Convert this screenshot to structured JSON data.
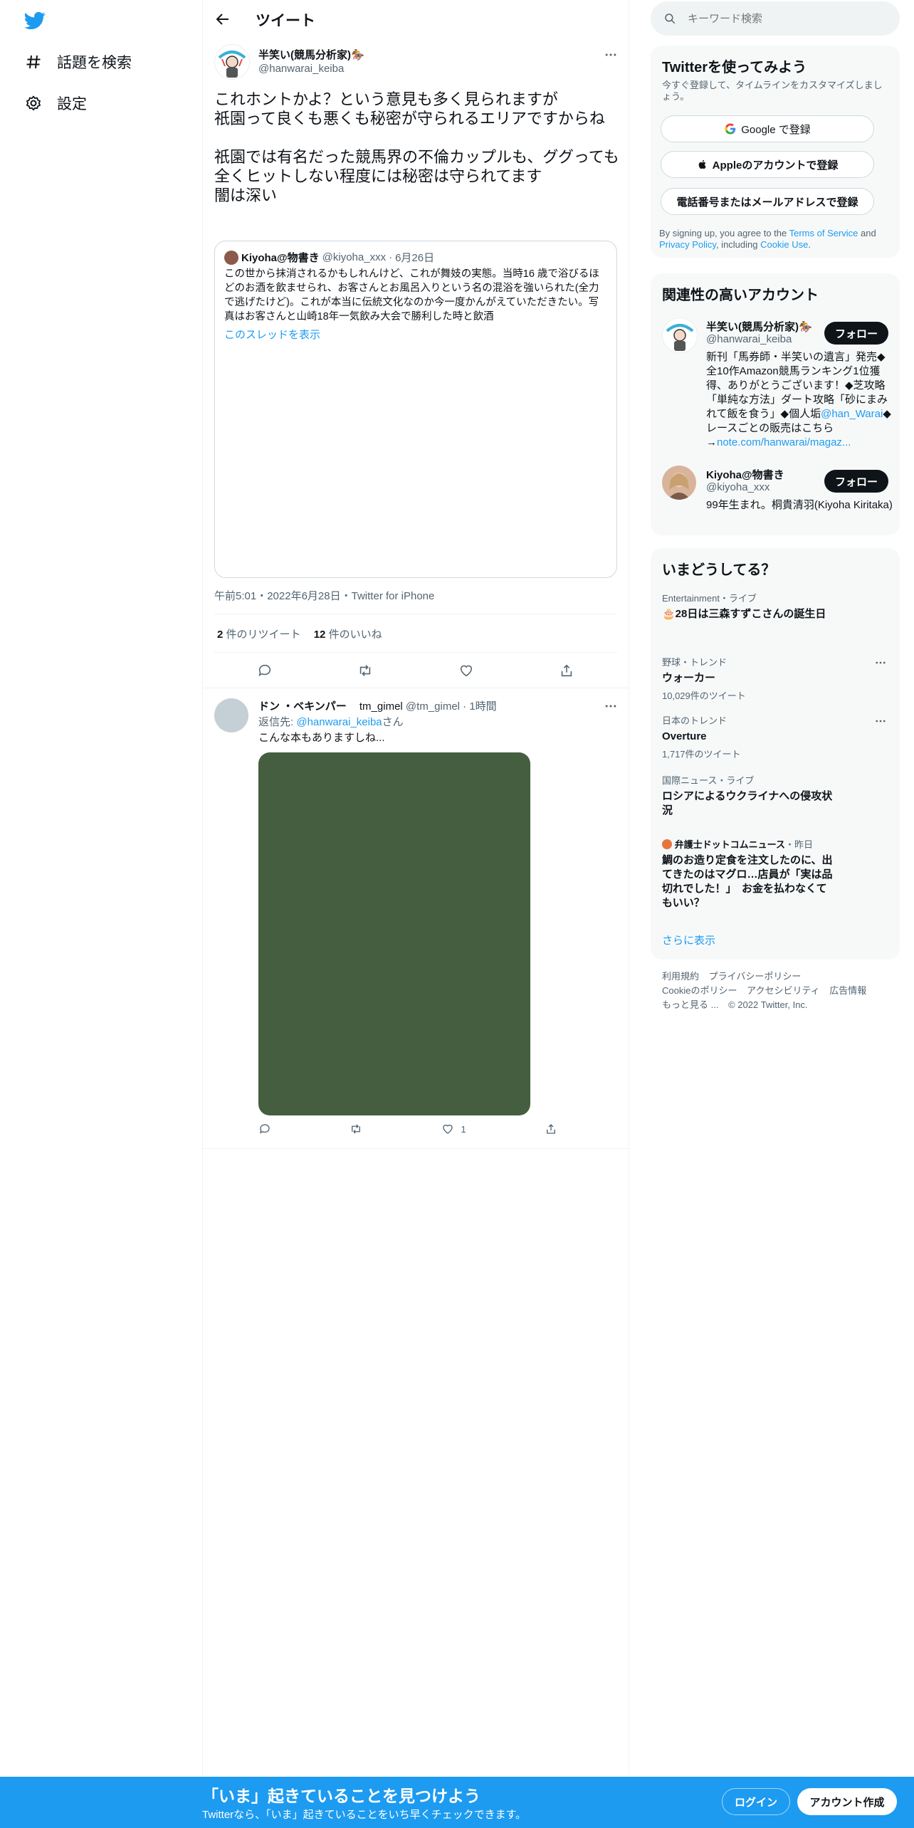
{
  "nav": {
    "items": [
      {
        "label": "話題を検索",
        "icon": "hashtag-icon"
      },
      {
        "label": "設定",
        "icon": "gear-icon"
      }
    ]
  },
  "header": {
    "title": "ツイート"
  },
  "tweet": {
    "author_name": "半笑い(競馬分析家)🏇",
    "handle": "@hanwarai_keiba",
    "text": "これホントかよ？という意見も多く見られますが\n祇園って良くも悪くも秘密が守られるエリアですからね\n\n祇園では有名だった競馬界の不倫カップルも、ググっても全くヒットしない程度には秘密は守られてます\n闇は深い",
    "quote": {
      "author_name": "Kiyoha@物書き",
      "handle": "@kiyoha_xxx",
      "date": "6月26日",
      "text": "この世から抹消されるかもしれんけど、これが舞妓の実態。当時16 歳で浴びるほどのお酒を飲ませられ、お客さんとお風呂入りという名の混浴を強いられた(全力で逃げたけど)。これが本当に伝統文化なのか今一度かんがえていただきたい。写真はお客さんと山崎18年一気飲み大会で勝利した時と飲酒",
      "show_thread": "このスレッドを表示"
    },
    "time": "午前5:01",
    "date": "2022年6月28日",
    "source": "Twitter for iPhone",
    "retweets": "2",
    "retweets_label": "件のリツイート",
    "likes": "12",
    "likes_label": "件のいいね"
  },
  "reply": {
    "author_name": "ドン ・ベキンパー",
    "handle_display": "tm_gimel",
    "handle": "@tm_gimel",
    "time": "1時間",
    "reply_to_prefix": "返信先: ",
    "reply_to_handle": "@hanwarai_keiba",
    "reply_to_suffix": "さん",
    "text": "こんな本もありますしね...",
    "media_color": "#455e3f",
    "like_count": "1"
  },
  "sidebar": {
    "search_placeholder": "キーワード検索",
    "signup": {
      "title": "Twitterを使ってみよう",
      "subtitle": "今すぐ登録して、タイムラインをカスタマイズしましょう。",
      "google": "Google で登録",
      "apple": "Appleのアカウントで登録",
      "phone": "電話番号またはメールアドレスで登録",
      "terms_prefix": "By signing up, you agree to the ",
      "terms_link": "Terms of Service",
      "terms_and": " and ",
      "privacy_link": "Privacy Policy",
      "terms_including": ", including ",
      "cookie_link": "Cookie Use",
      "terms_end": "."
    },
    "relevant": {
      "title": "関連性の高いアカウント",
      "follow_label": "フォロー",
      "accounts": [
        {
          "name": "半笑い(競馬分析家)🏇",
          "handle": "@hanwarai_keiba",
          "bio_before": "新刊「馬券師・半笑いの遺言」発売◆全10作Amazon競馬ランキング1位獲得、ありがとうございます！◆芝攻略「単純な方法」ダート攻略「砂にまみれて飯を食う」◆個人垢",
          "bio_link1": "@han_Warai",
          "bio_middle": "◆レースごとの販売はこちら→",
          "bio_link2": "note.com/hanwarai/magaz..."
        },
        {
          "name": "Kiyoha@物書き",
          "handle": "@kiyoha_xxx",
          "bio": "99年生まれ。桐貴清羽(Kiyoha Kiritaka)"
        }
      ]
    },
    "trends": {
      "title": "いまどうしてる？",
      "items": [
        {
          "context": "Entertainment・ライブ",
          "name": "🎂28日は三森すずこさんの誕生日",
          "count": ""
        },
        {
          "context": "野球・トレンド",
          "name": "ウォーカー",
          "count": "10,029件のツイート"
        },
        {
          "context": "日本のトレンド",
          "name": "Overture",
          "count": "1,717件のツイート"
        },
        {
          "context": "国際ニュース・ライブ",
          "name": "ロシアによるウクライナへの侵攻状況",
          "count": ""
        },
        {
          "context_source": "弁護士ドットコムニュース",
          "context_time": "・昨日",
          "name": "鯛のお造り定食を注文したのに、出てきたのはマグロ…店員が「実は品切れでした！」　お金を払わなくてもいい？",
          "count": ""
        }
      ],
      "show_more": "さらに表示"
    },
    "footer": {
      "links": [
        "利用規約",
        "プライバシーポリシー",
        "Cookieのポリシー",
        "アクセシビリティ",
        "広告情報",
        "もっと見る ..."
      ],
      "copyright": "© 2022 Twitter, Inc."
    }
  },
  "bottom_bar": {
    "headline": "「いま」起きていることを見つけよう",
    "subline": "Twitterなら、「いま」起きていることをいち早くチェックできます。",
    "login": "ログイン",
    "signup": "アカウント作成"
  },
  "colors": {
    "brand": "#1d9bf0",
    "text": "#0f1419",
    "secondary": "#536471"
  }
}
